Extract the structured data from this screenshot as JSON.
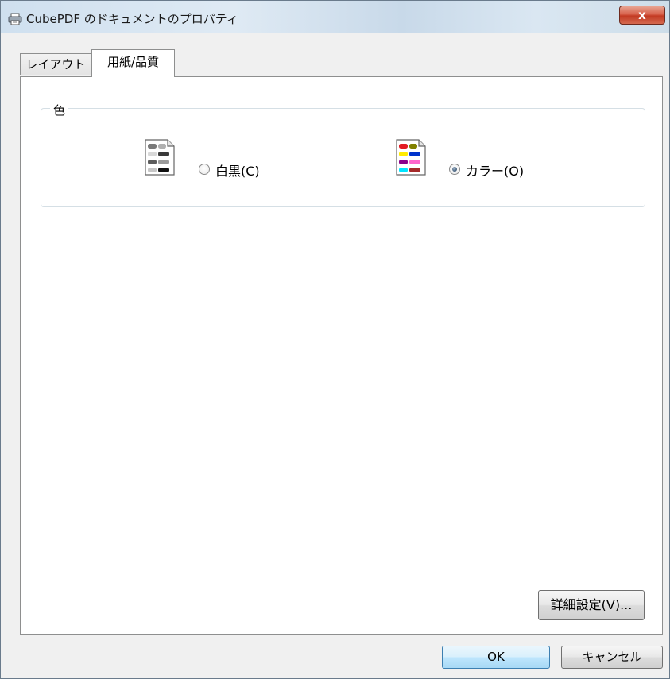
{
  "window": {
    "title": "CubePDF のドキュメントのプロパティ",
    "close_label": "x",
    "icon": "printer-icon"
  },
  "tabs": [
    {
      "label": "レイアウト",
      "selected": false
    },
    {
      "label": "用紙/品質",
      "selected": true
    }
  ],
  "color_group": {
    "label": "色",
    "options": [
      {
        "label": "白黒(C)",
        "checked": false,
        "icon": "monochrome-document-icon"
      },
      {
        "label": "カラー(O)",
        "checked": true,
        "icon": "color-document-icon"
      }
    ]
  },
  "buttons": {
    "advanced": "詳細設定(V)...",
    "ok": "OK",
    "cancel": "キャンセル"
  },
  "colors": {
    "accent": "#3c7fb1",
    "close": "#c23a22",
    "icon_colors": [
      "#e31b23",
      "#808000",
      "#ffeb00",
      "#0033cc",
      "#8b008b",
      "#ff66cc",
      "#00e5ff",
      "#a52a2a"
    ]
  }
}
